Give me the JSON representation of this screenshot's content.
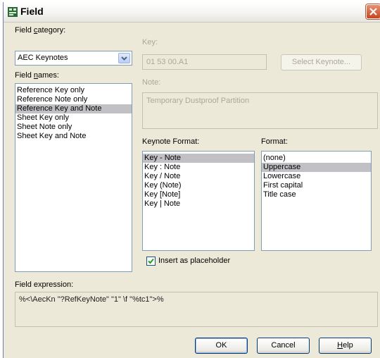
{
  "window": {
    "title": "Field",
    "icon": "field-icon",
    "close_icon": "close-icon"
  },
  "left": {
    "category_label_pre": "Field ",
    "category_label_ul": "c",
    "category_label_post": "ategory:",
    "category_value": "AEC Keynotes",
    "names_label_pre": "Field ",
    "names_label_ul": "n",
    "names_label_post": "ames:",
    "names": [
      "Reference Key only",
      "Reference Note only",
      "Reference Key and Note",
      "Sheet Key only",
      "Sheet Note only",
      "Sheet Key and Note"
    ],
    "names_selected": "Reference Key and Note"
  },
  "key": {
    "label": "Key:",
    "value": "01 53 00.A1",
    "select_button": "Select Keynote..."
  },
  "note": {
    "label": "Note:",
    "value": "Temporary Dustproof Partition"
  },
  "keynote_format": {
    "label": "Keynote Format:",
    "options": [
      "Key - Note",
      "Key : Note",
      "Key / Note",
      "Key (Note)",
      "Key [Note]",
      "Key | Note"
    ],
    "selected": "Key - Note"
  },
  "format": {
    "label": "Format:",
    "options": [
      "(none)",
      "Uppercase",
      "Lowercase",
      "First capital",
      "Title case"
    ],
    "selected": "Uppercase"
  },
  "placeholder": {
    "label": "Insert as placeholder",
    "checked": true
  },
  "expression": {
    "label": "Field expression:",
    "value": "%<\\AecKn \"?RefKeyNote\" \"1\" \\f \"%tc1\">%"
  },
  "buttons": {
    "ok": "OK",
    "cancel": "Cancel",
    "help_ul": "H",
    "help_rest": "elp"
  }
}
